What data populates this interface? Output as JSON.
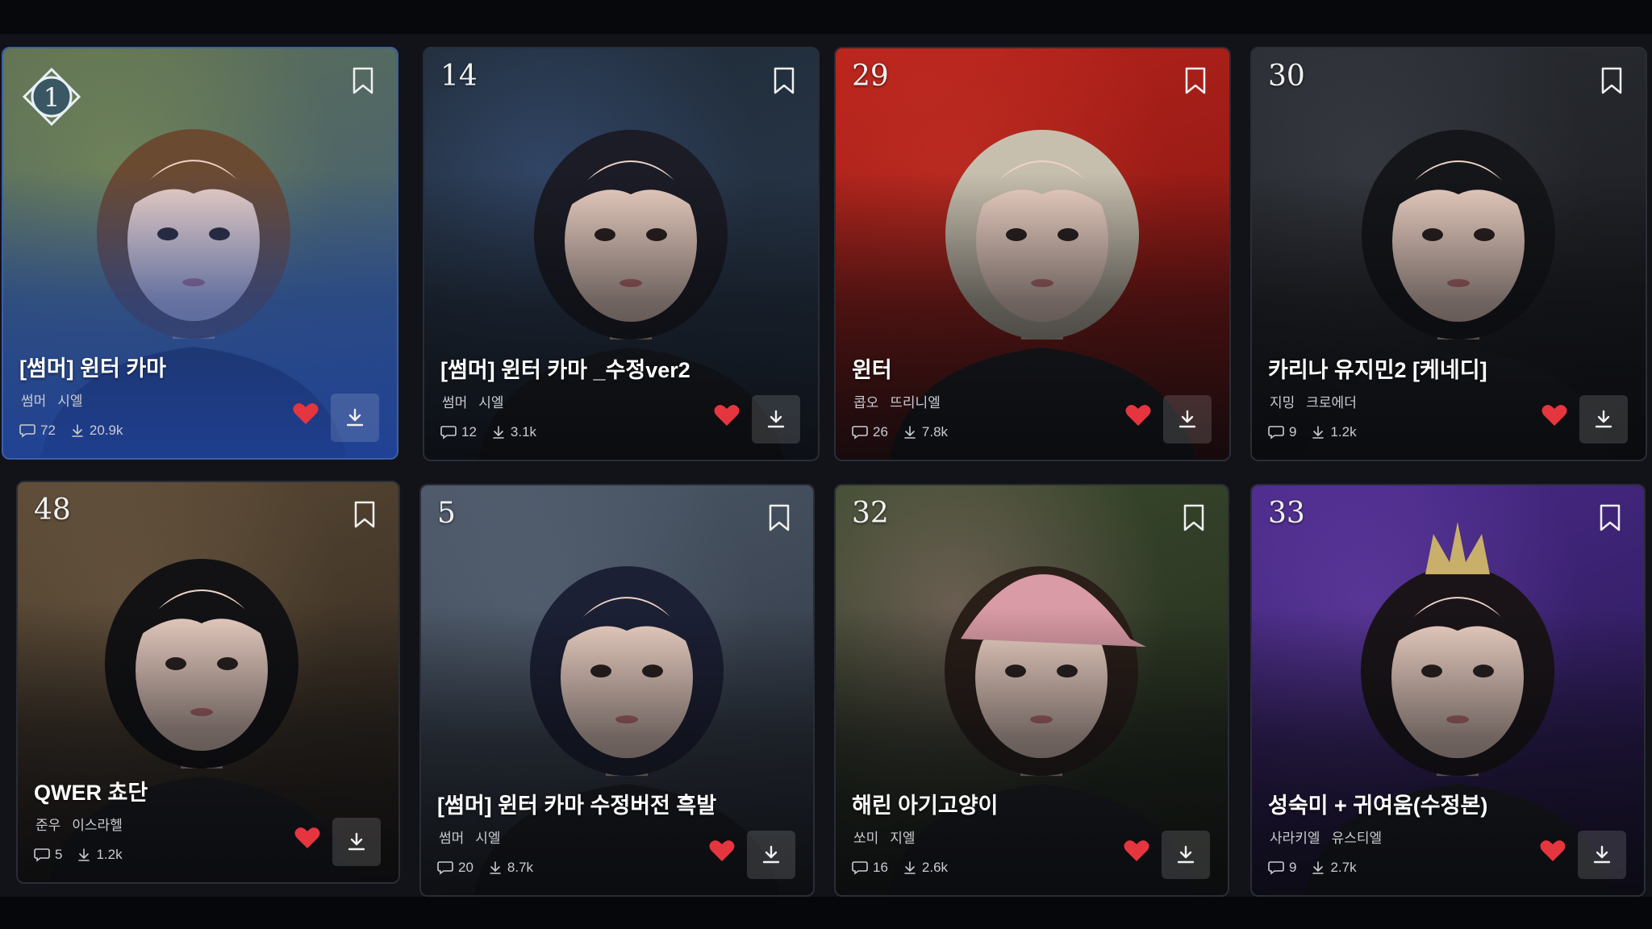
{
  "cards": [
    {
      "rank": "1",
      "title": "[썸머] 윈터 카마",
      "author1": "썸머",
      "author2": "시엘",
      "comments": "72",
      "downloads": "20.9k",
      "bg": [
        "#5d6f55",
        "#3d5a80"
      ],
      "hair": "#6b4a32",
      "accent": "#a3b34a"
    },
    {
      "rank": "14",
      "title": "[썸머] 윈터 카마 _수정ver2",
      "author1": "썸머",
      "author2": "시엘",
      "comments": "12",
      "downloads": "3.1k",
      "bg": [
        "#1f2a35",
        "#2c3d55"
      ],
      "hair": "#1b1c26",
      "accent": "#4d6fb0"
    },
    {
      "rank": "29",
      "title": "윈터",
      "author1": "콥오",
      "author2": "뜨리니엘",
      "comments": "26",
      "downloads": "7.8k",
      "bg": [
        "#b8231c",
        "#7a1410"
      ],
      "hair": "#c7bfae",
      "accent": "#e0412f"
    },
    {
      "rank": "30",
      "title": "카리나 유지민2 [케네디]",
      "author1": "지밍",
      "author2": "크로에더",
      "comments": "9",
      "downloads": "1.2k",
      "bg": [
        "#2a2d33",
        "#18191d"
      ],
      "hair": "#151619",
      "accent": "#555a63"
    },
    {
      "rank": "48",
      "title": "QWER 쵸단",
      "author1": "준우",
      "author2": "이스라헬",
      "comments": "5",
      "downloads": "1.2k",
      "bg": [
        "#5b4a36",
        "#2a221a"
      ],
      "hair": "#121214",
      "accent": "#8a7255"
    },
    {
      "rank": "5",
      "title": "[썸머] 윈터 카마 수정버전 흑발",
      "author1": "썸머",
      "author2": "시엘",
      "comments": "20",
      "downloads": "8.7k",
      "bg": [
        "#4c5868",
        "#2b323d"
      ],
      "hair": "#1c2035",
      "accent": "#6f7d92"
    },
    {
      "rank": "32",
      "title": "해린 아기고양이",
      "author1": "쏘미",
      "author2": "지엘",
      "comments": "16",
      "downloads": "2.6k",
      "bg": [
        "#3b4a2e",
        "#1f2619"
      ],
      "hair": "#2a1e18",
      "accent": "#d99ba5"
    },
    {
      "rank": "33",
      "title": "성숙미 + 귀여움(수정본)",
      "author1": "사라키엘",
      "author2": "유스티엘",
      "comments": "9",
      "downloads": "2.7k",
      "bg": [
        "#4a2a8a",
        "#24164a"
      ],
      "hair": "#1a1418",
      "accent": "#8c5ad6"
    }
  ],
  "colors": {
    "heart": "#e5353f",
    "active_border": "#3b5fa8",
    "active_tint": "#2a4f9e"
  },
  "icons": {
    "bookmark": "bookmark-icon",
    "comment": "comment-icon",
    "download": "download-icon",
    "like": "heart-icon",
    "rank_badge": "rank-badge-icon"
  }
}
